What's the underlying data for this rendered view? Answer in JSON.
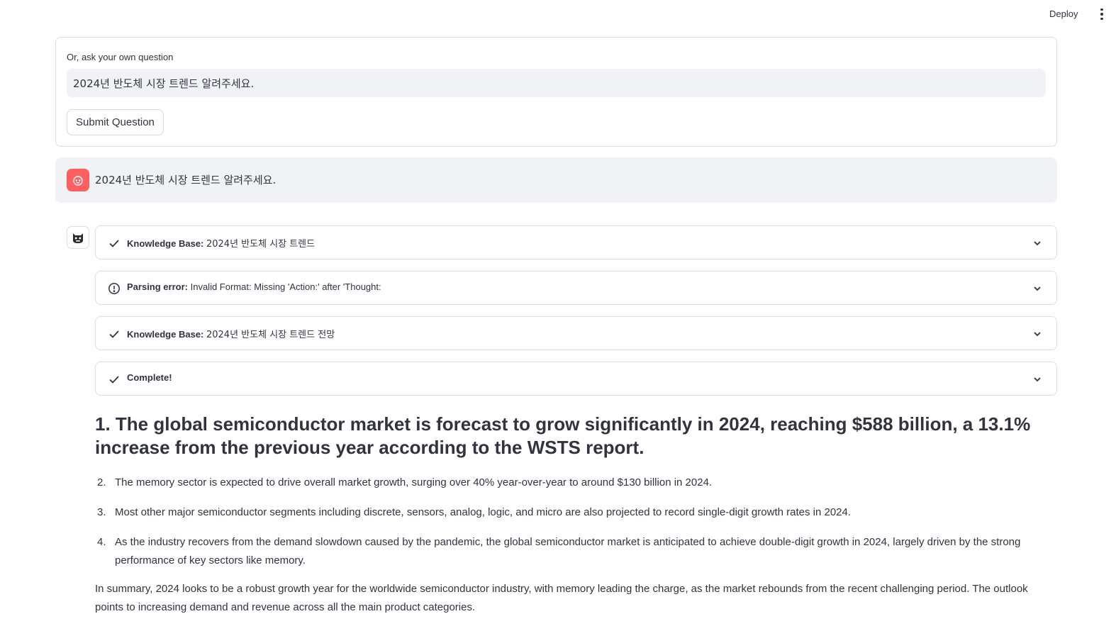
{
  "header": {
    "deploy_label": "Deploy",
    "menu_icon": "vertical-ellipsis-icon"
  },
  "question_form": {
    "label": "Or, ask your own question",
    "input_value": "2024년 반도체 시장 트렌드 알려주세요.",
    "submit_label": "Submit Question"
  },
  "user_message": {
    "avatar_icon": "user-face-icon",
    "avatar_color": "#ff5f5f",
    "text": "2024년 반도체 시장 트렌드 알려주세요."
  },
  "assistant": {
    "avatar_icon": "bot-face-icon",
    "steps": [
      {
        "status": "complete",
        "title": "Knowledge Base:",
        "detail": "2024년 반도체 시장 트렌드"
      },
      {
        "status": "error",
        "title": "Parsing error:",
        "detail": "Invalid Format: Missing 'Action:' after 'Thought:"
      },
      {
        "status": "complete",
        "title": "Knowledge Base:",
        "detail": "2024년 반도체 시장 트렌드 전망"
      },
      {
        "status": "complete",
        "title": "Complete!",
        "detail": ""
      }
    ],
    "answer": {
      "heading": "1. The global semiconductor market is forecast to grow significantly in 2024, reaching $588 billion, a 13.1% increase from the previous year according to the WSTS report.",
      "items": [
        {
          "number": "2.",
          "text": "The memory sector is expected to drive overall market growth, surging over 40% year-over-year to around $130 billion in 2024."
        },
        {
          "number": "3.",
          "text": "Most other major semiconductor segments including discrete, sensors, analog, logic, and micro are also projected to record single-digit growth rates in 2024."
        },
        {
          "number": "4.",
          "text": "As the industry recovers from the demand slowdown caused by the pandemic, the global semiconductor market is anticipated to achieve double-digit growth in 2024, largely driven by the strong performance of key sectors like memory."
        }
      ],
      "summary": "In summary, 2024 looks to be a robust growth year for the worldwide semiconductor industry, with memory leading the charge, as the market rebounds from the recent challenging period. The outlook points to increasing demand and revenue across all the main product categories."
    }
  }
}
